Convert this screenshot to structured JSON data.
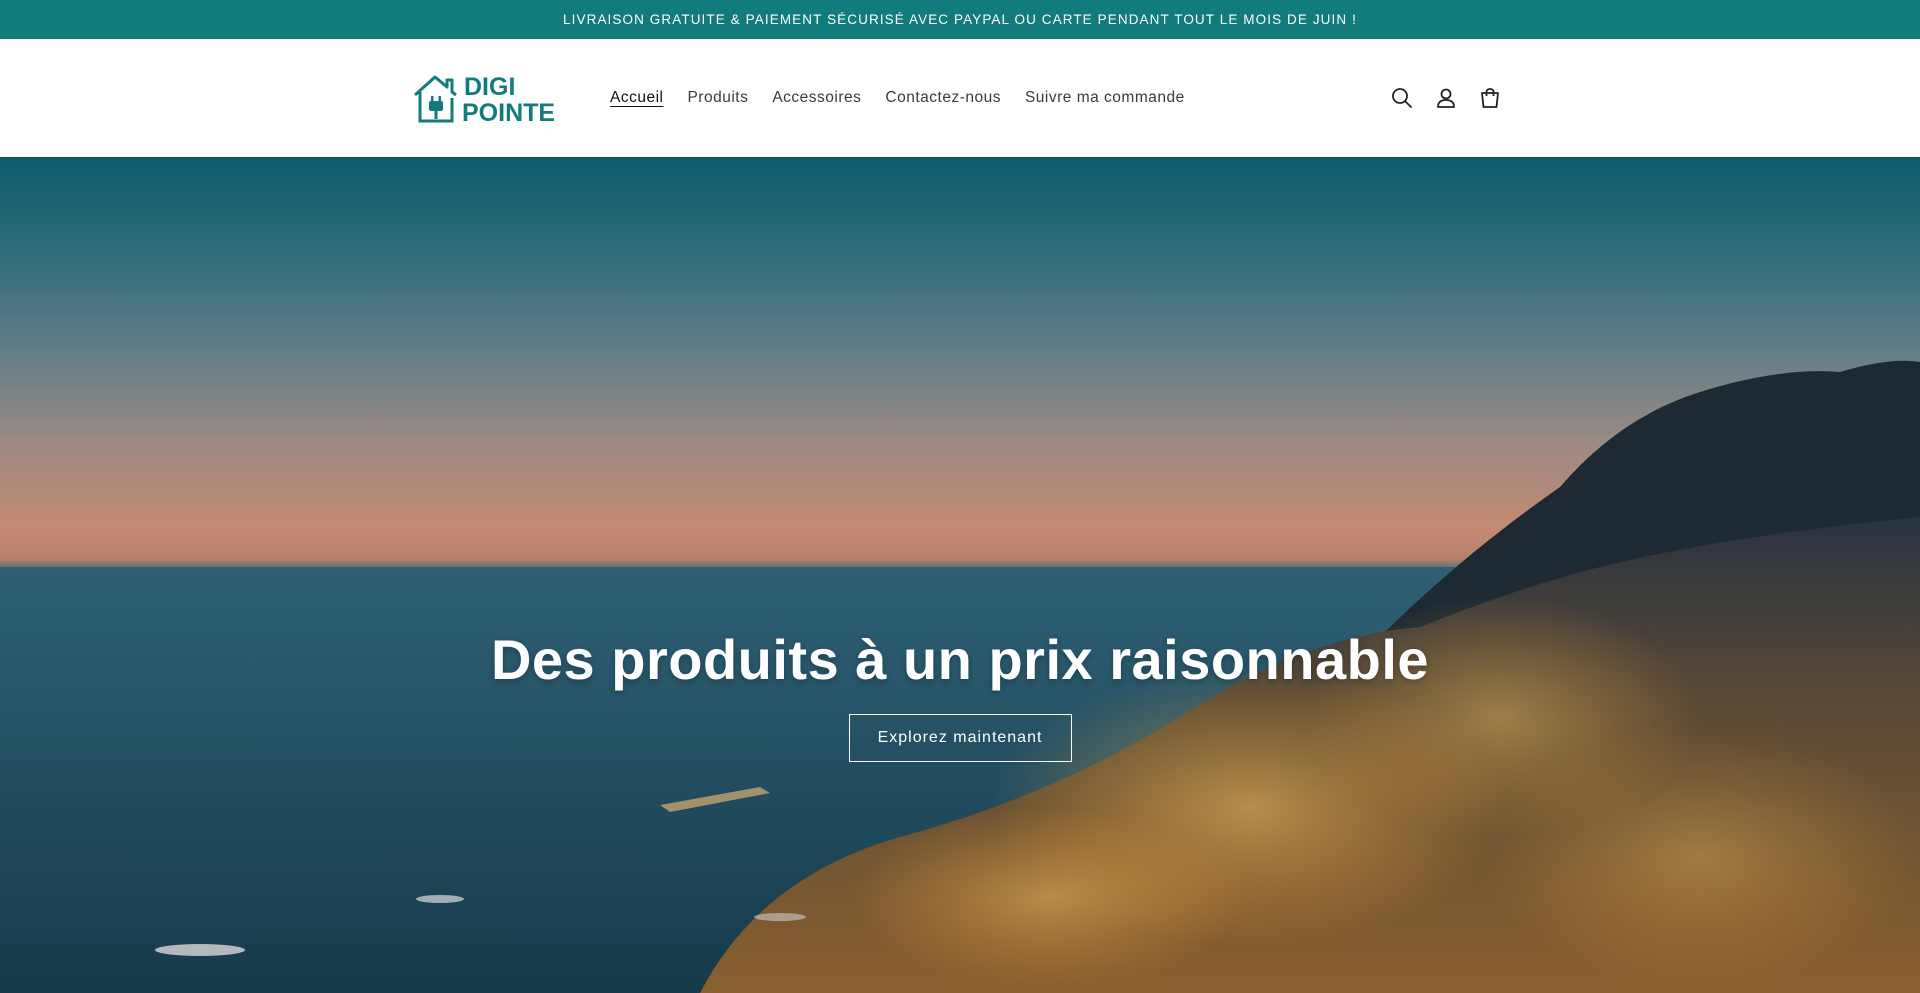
{
  "announcement": {
    "text": "LIVRAISON GRATUITE & PAIEMENT SÉCURISÉ AVEC PAYPAL OU CARTE PENDANT TOUT LE MOIS DE JUIN !"
  },
  "header": {
    "logo": {
      "line1": "DIGI",
      "line2": "POINTE",
      "icon": "house-plug-icon"
    },
    "nav": [
      {
        "label": "Accueil",
        "active": true
      },
      {
        "label": "Produits",
        "active": false
      },
      {
        "label": "Accessoires",
        "active": false
      },
      {
        "label": "Contactez-nous",
        "active": false
      },
      {
        "label": "Suivre ma commande",
        "active": false
      }
    ],
    "icons": [
      "search-icon",
      "account-icon",
      "cart-icon"
    ]
  },
  "hero": {
    "title": "Des produits à un prix raisonnable",
    "button_label": "Explorez maintenant"
  },
  "colors": {
    "brand": "#127c7c",
    "announcement_text": "#ffffff",
    "nav_text": "#3a3a3a"
  }
}
